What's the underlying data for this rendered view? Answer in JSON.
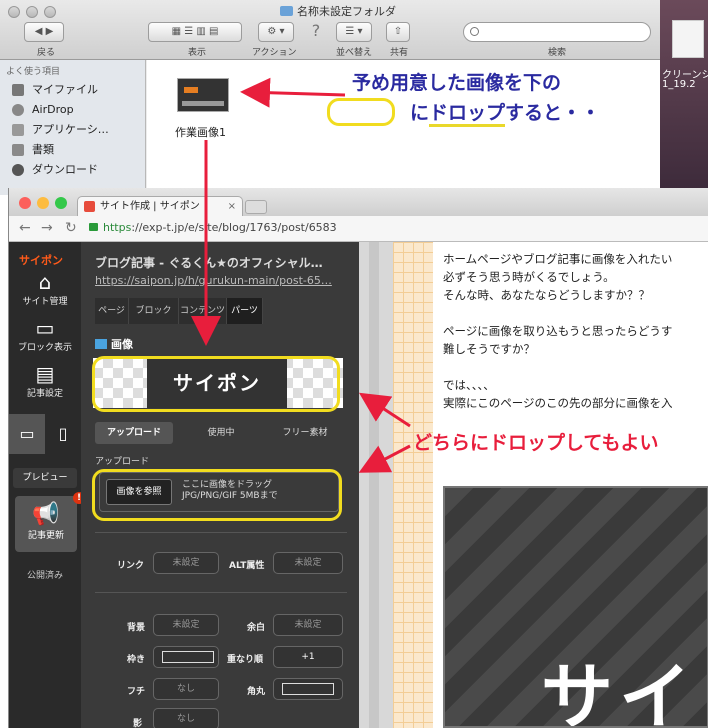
{
  "finder": {
    "title": "名称未設定フォルダ",
    "toolbar": {
      "back_label": "戻る",
      "view_label": "表示",
      "action_label": "アクション",
      "arrange_label": "並べ替え",
      "share_label": "共有",
      "search_label": "検索"
    },
    "sidebar": {
      "heading": "よく使う項目",
      "items": [
        {
          "label": "マイファイル",
          "icon": "files-icon"
        },
        {
          "label": "AirDrop",
          "icon": "airdrop-icon"
        },
        {
          "label": "アプリケーシ…",
          "icon": "apps-icon"
        },
        {
          "label": "書類",
          "icon": "documents-icon"
        },
        {
          "label": "ダウンロード",
          "icon": "download-icon"
        }
      ]
    },
    "file": {
      "name": "作業画像1"
    }
  },
  "desktop": {
    "label_1": "クリーンシ",
    "label_2": "1_19.2"
  },
  "browser": {
    "tab_title": "サイト作成 | サイポン",
    "url_scheme": "https",
    "url_rest": "://exp-t.jp/e/site/blog/1763/post/6583"
  },
  "saipon": {
    "logo": "サイポン",
    "nav": [
      {
        "label": "サイト管理",
        "icon": "house-icon"
      },
      {
        "label": "ブロック表示",
        "icon": "devices-icon"
      },
      {
        "label": "記事設定",
        "icon": "document-icon"
      }
    ],
    "preview_label": "プレビュー",
    "update_label": "記事更新",
    "badge": "!",
    "public_label": "公開済み"
  },
  "editor": {
    "title": "ブログ記事 - ぐるくん★のオフィシャル…",
    "link": "https://saipon.jp/h/gurukun-main/post-65…",
    "tabs": [
      "ページ",
      "ブロック",
      "コンテンツ",
      "パーツ"
    ],
    "active_tab": "パーツ",
    "section": "画像",
    "preview_text": "サイポン",
    "subtabs": [
      "アップロード",
      "使用中",
      "フリー素材"
    ],
    "upload_heading": "アップロード",
    "browse_label": "画像を参照",
    "hint_line1": "ここに画像をドラッグ",
    "hint_line2": "JPG/PNG/GIF 5MBまで",
    "link_label": "リンク",
    "alt_label": "ALT属性",
    "unset": "未設定",
    "bg_label": "背景",
    "margin_label": "余白",
    "border_label": "枠き",
    "overlap_label": "重なり順",
    "overlap_value": "+1",
    "edge_label": "フチ",
    "none": "なし",
    "corner_label": "角丸",
    "shadow_label": "影"
  },
  "page": {
    "lines": [
      "ホームページやブログ記事に画像を入れたい",
      "必ずそう思う時がくるでしょう。",
      "そんな時、あなたならどうしますか？？",
      "",
      "ページに画像を取り込もうと思ったらどうす",
      "難しそうですか？",
      "",
      "では、、、、",
      "実際にこのページのこの先の部分に画像を入"
    ],
    "image_text": "サイ"
  },
  "annotations": {
    "blue_line1": "予め用意した画像を下の",
    "blue_line2_prefix": "に",
    "blue_line2_drop": "ドロップ",
    "blue_line2_suffix": "すると・・",
    "red": "どちらにドロップしてもよい",
    "colors": {
      "blue": "#2a2aa0",
      "red": "#e81e3c",
      "yellow": "#f1dc1f"
    }
  }
}
